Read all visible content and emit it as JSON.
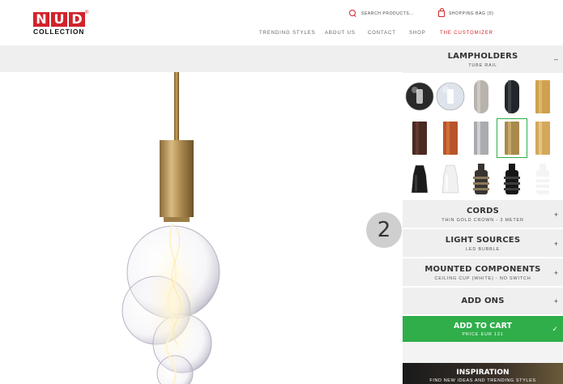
{
  "brand": {
    "letters": [
      "N",
      "U",
      "D"
    ],
    "registered": "®",
    "subtitle": "COLLECTION"
  },
  "header": {
    "search_placeholder": "SEARCH PRODUCTS...",
    "bag_label": "SHOPPING BAG (0)",
    "nav": [
      "TRENDING STYLES",
      "ABOUT US",
      "CONTACT",
      "SHOP",
      "THE CUSTOMIZER"
    ],
    "active_nav": "THE CUSTOMIZER"
  },
  "preview": {
    "step_number": "2"
  },
  "sidebar": {
    "lampholders": {
      "title": "LAMPHOLDERS",
      "subtitle": "TUBE RAIL",
      "toggle": "–"
    },
    "cords": {
      "title": "CORDS",
      "subtitle": "THIN GOLD CROWN - 3 METER",
      "toggle": "+"
    },
    "light_sources": {
      "title": "LIGHT SOURCES",
      "subtitle": "LED BUBBLE",
      "toggle": "+"
    },
    "mounted": {
      "title": "MOUNTED COMPONENTS",
      "subtitle": "CEILING CUP (WHITE) - NO SWITCH",
      "toggle": "+"
    },
    "addons": {
      "title": "ADD ONS",
      "toggle": "+"
    },
    "cart": {
      "title": "ADD TO CART",
      "price": "PRICE EUR 131",
      "check": "✓"
    },
    "inspiration": {
      "title": "INSPIRATION",
      "subtitle": "FIND NEW IDEAS AND TRENDING STYLES"
    },
    "lampholder_options": [
      {
        "color": "#2a2a2a",
        "accent": "#cfcfcf",
        "shape": "sphere"
      },
      {
        "color": "#dfe4ec",
        "accent": "#ffffff",
        "shape": "sphere"
      },
      {
        "color": "#b9b3ad",
        "accent": "#d8d2cc",
        "shape": "tube"
      },
      {
        "color": "#22252b",
        "accent": "#4a4e57",
        "shape": "tube"
      },
      {
        "color": "#cfa14f",
        "accent": "#e2c07a",
        "shape": "tube"
      },
      {
        "color": "#4a2a22",
        "accent": "#6e4034",
        "shape": "tube"
      },
      {
        "color": "#b8552a",
        "accent": "#d97a45",
        "shape": "tube"
      },
      {
        "color": "#a9abae",
        "accent": "#dedfe1",
        "shape": "tube"
      },
      {
        "color": "#a88a4e",
        "accent": "#d3b676",
        "shape": "tube",
        "selected": true
      },
      {
        "color": "#d4a85a",
        "accent": "#ecd196",
        "shape": "tube"
      },
      {
        "color": "#1b1b1b",
        "accent": "#444444",
        "shape": "socket"
      },
      {
        "color": "#f1f1f1",
        "accent": "#ffffff",
        "shape": "socket"
      },
      {
        "color": "#3a3430",
        "accent": "#8a7a5a",
        "shape": "ribbed"
      },
      {
        "color": "#161616",
        "accent": "#3d3d3d",
        "shape": "ribbed"
      },
      {
        "color": "#f4f4f4",
        "accent": "#ffffff",
        "shape": "ribbed"
      }
    ]
  }
}
